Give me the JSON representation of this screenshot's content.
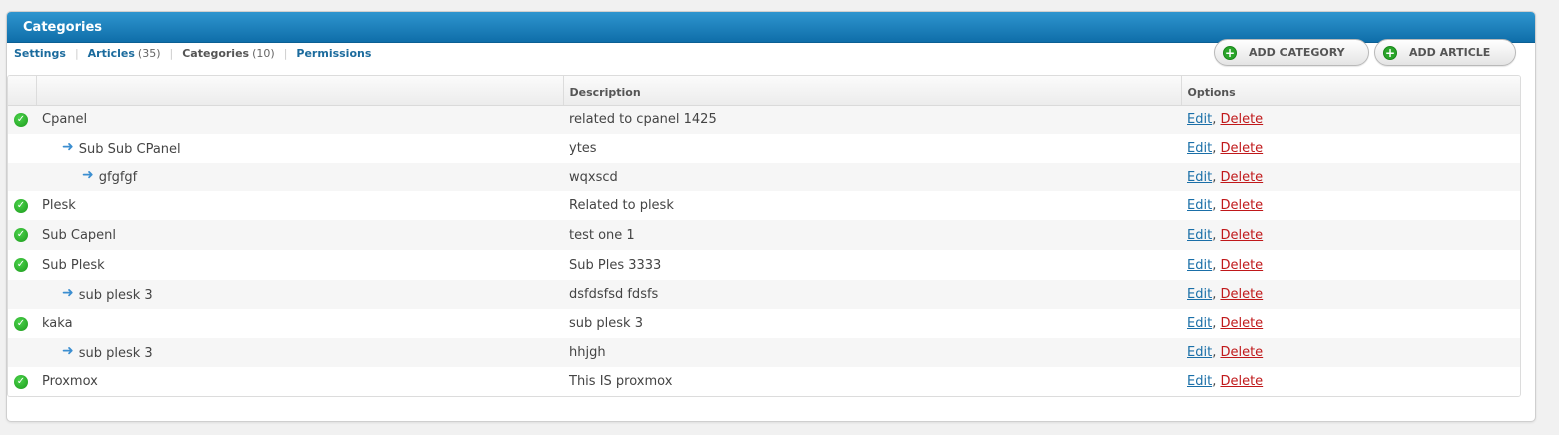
{
  "panel": {
    "title": "Categories"
  },
  "subnav": {
    "settings": "Settings",
    "articles": "Articles",
    "articles_count": "(35)",
    "categories": "Categories",
    "categories_count": "(10)",
    "permissions": "Permissions"
  },
  "buttons": {
    "add_category": "ADD CATEGORY",
    "add_article": "ADD ARTICLE"
  },
  "table": {
    "headers": {
      "name": "",
      "description": "Description",
      "options": "Options"
    },
    "edit_label": "Edit",
    "delete_label": "Delete",
    "rows": [
      {
        "name": "Cpanel",
        "description": "related to cpanel 1425",
        "level": 0
      },
      {
        "name": "Sub Sub CPanel",
        "description": "ytes",
        "level": 1
      },
      {
        "name": "gfgfgf",
        "description": "wqxscd",
        "level": 2
      },
      {
        "name": "Plesk",
        "description": "Related to plesk",
        "level": 0
      },
      {
        "name": "Sub Capenl",
        "description": "test one 1",
        "level": 0
      },
      {
        "name": "Sub Plesk",
        "description": "Sub Ples 3333",
        "level": 0
      },
      {
        "name": "sub plesk 3",
        "description": "dsfdsfsd fdsfs",
        "level": 1
      },
      {
        "name": "kaka",
        "description": "sub plesk 3",
        "level": 0
      },
      {
        "name": "sub plesk 3",
        "description": "hhjgh",
        "level": 1
      },
      {
        "name": "Proxmox",
        "description": "This IS proxmox",
        "level": 0
      }
    ]
  },
  "colors": {
    "header_blue": "#1b7fbd",
    "link_blue": "#1a6fa8",
    "delete_red": "#c0181a",
    "status_green": "#2aa52a"
  },
  "icons": {
    "status": "check-circle-icon",
    "child": "sub-arrow-icon",
    "add": "plus-circle-icon"
  }
}
